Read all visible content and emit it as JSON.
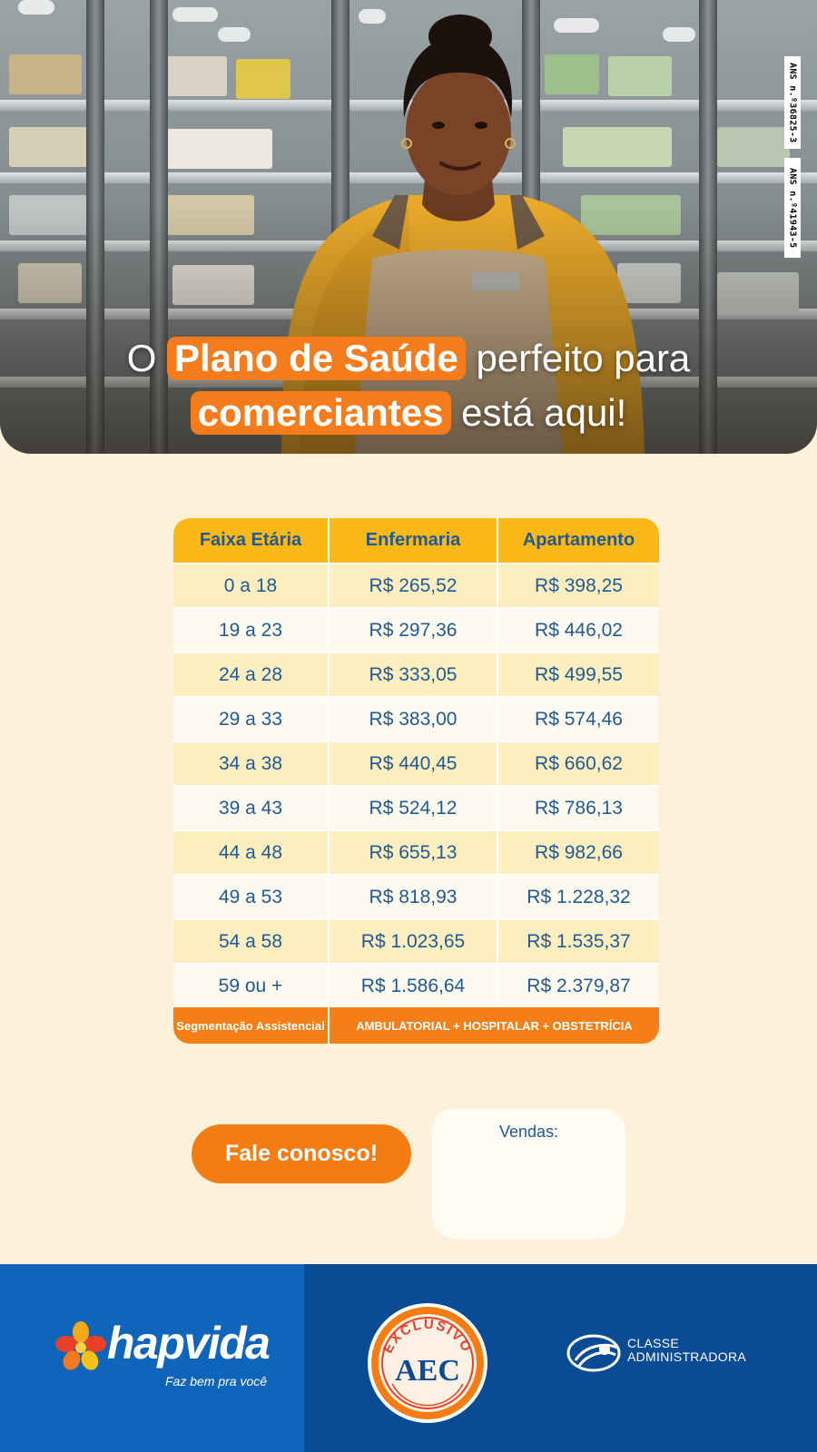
{
  "hero": {
    "headline": {
      "line1_prefix": "O",
      "line1_highlight": "Plano de Saúde",
      "line1_suffix": "perfeito para",
      "line2_highlight": "comerciantes",
      "line2_suffix": "está aqui!"
    },
    "ans_registrations": [
      "ANS n.º36825-3",
      "ANS n.º41943-5"
    ]
  },
  "price_table": {
    "headers": [
      "Faixa Etária",
      "Enfermaria",
      "Apartamento"
    ],
    "rows": [
      [
        "0 a 18",
        "R$ 265,52",
        "R$ 398,25"
      ],
      [
        "19 a 23",
        "R$ 297,36",
        "R$ 446,02"
      ],
      [
        "24 a 28",
        "R$ 333,05",
        "R$ 499,55"
      ],
      [
        "29 a 33",
        "R$ 383,00",
        "R$ 574,46"
      ],
      [
        "34 a 38",
        "R$ 440,45",
        "R$ 660,62"
      ],
      [
        "39 a 43",
        "R$ 524,12",
        "R$ 786,13"
      ],
      [
        "44 a 48",
        "R$ 655,13",
        "R$ 982,66"
      ],
      [
        "49 a 53",
        "R$ 818,93",
        "R$ 1.228,32"
      ],
      [
        "54 a 58",
        "R$ 1.023,65",
        "R$ 1.535,37"
      ],
      [
        "59 ou +",
        "R$ 1.586,64",
        "R$ 2.379,87"
      ]
    ],
    "footer_label": "Segmentação Assistencial",
    "footer_value": "AMBULATORIAL + HOSPITALAR + OBSTETRÍCIA"
  },
  "cta": {
    "label": "Fale conosco!"
  },
  "sales": {
    "label": "Vendas:"
  },
  "footer": {
    "hapvida": {
      "name": "hapvida",
      "tagline": "Faz bem pra você"
    },
    "seal": {
      "top_text": "EXCLUSIVO",
      "center_text": "AEC"
    },
    "classe": {
      "line1": "CLASSE",
      "line2": "ADMINISTRADORA"
    }
  },
  "colors": {
    "background": "#fdf1d9",
    "accent_orange": "#f47c1c",
    "table_header": "#fbb817",
    "text_blue": "#1f5a94",
    "footer_blue_left": "#0f65b9",
    "footer_blue_right": "#0a4b96"
  }
}
